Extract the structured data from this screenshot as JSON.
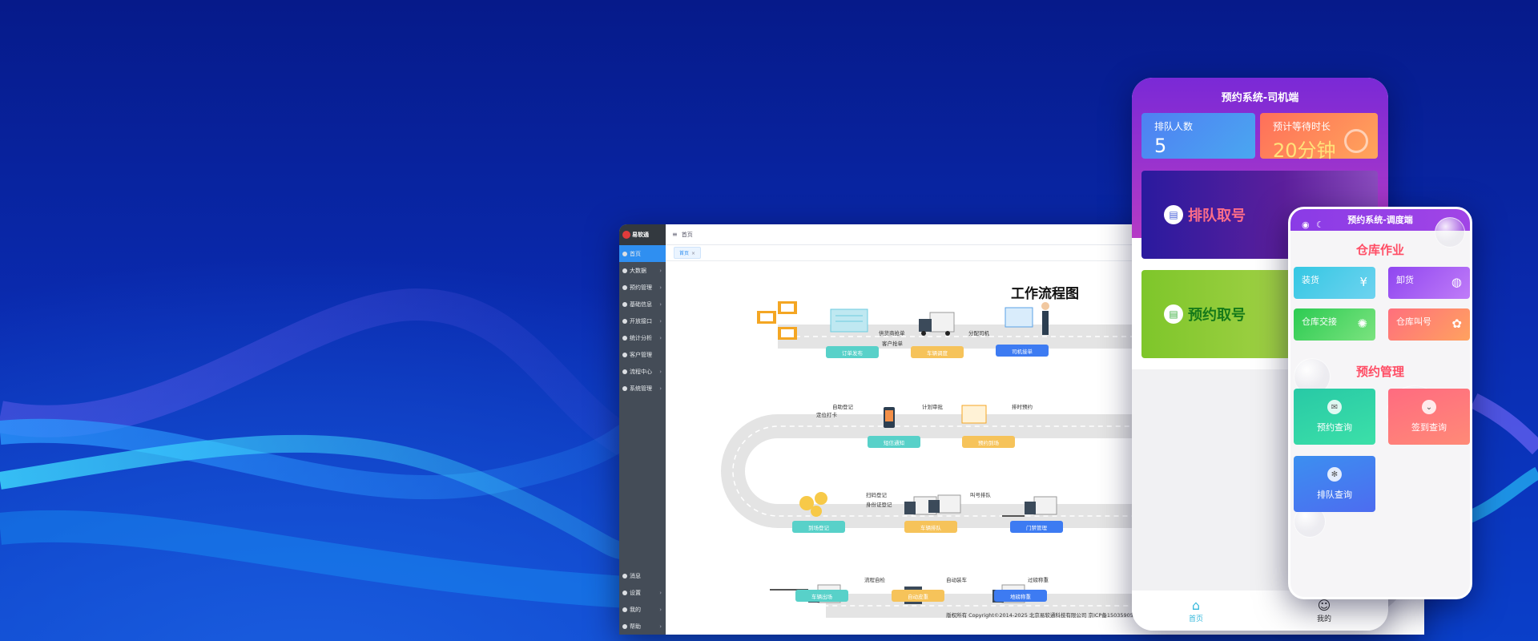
{
  "desktop": {
    "logo_text": "易软通",
    "breadcrumb": "首页",
    "tab_label": "首页",
    "tab_close": "×",
    "menu": [
      {
        "label": "首页",
        "active": true
      },
      {
        "label": "大数据",
        "chevron": true
      },
      {
        "label": "预约管理",
        "chevron": true
      },
      {
        "label": "基础信息",
        "chevron": true
      },
      {
        "label": "开放接口",
        "chevron": true
      },
      {
        "label": "统计分析",
        "chevron": true
      },
      {
        "label": "客户管理"
      },
      {
        "label": "流程中心",
        "chevron": true
      },
      {
        "label": "系统管理",
        "chevron": true
      }
    ],
    "menu_bottom": [
      {
        "label": "消息"
      },
      {
        "label": "设置",
        "chevron": true
      },
      {
        "label": "我的",
        "chevron": true
      },
      {
        "label": "帮助",
        "chevron": true
      }
    ],
    "flow_title": "工作流程图",
    "steps": {
      "order_publish": "订单发布",
      "vehicle_dispatch": "车辆调度",
      "driver_accept": "司机接单",
      "sms_notice": "短信通知",
      "appointment": "预约到场",
      "arrival_register": "到场登记",
      "vehicle_queue": "车辆排队",
      "gate_manage": "门禁管理",
      "vehicle_exit": "车辆出场",
      "auto_tare": "自动皮重",
      "ground_weigh": "地磅称重"
    },
    "labels": {
      "supplier_order": "供货商抢单",
      "customer_order": "客户抢单",
      "assign_driver": "分配司机",
      "self_register": "自助登记",
      "gps_checkin": "定位打卡",
      "plan_review": "计划审批",
      "timed_booking": "排时预约",
      "scan_register": "扫码登记",
      "id_register": "身份证登记",
      "call_queue": "叫号排队",
      "process_auto": "流程自检",
      "auto_load": "自动装车",
      "pass_weigh": "过磅称重"
    },
    "footer": "版权所有 Copyright©2014-2025 北京易软通科技有限公司 京ICP备15035905号-1"
  },
  "phone_driver": {
    "title": "预约系统-司机端",
    "queue_count_label": "排队人数",
    "queue_count_value": "5",
    "wait_time_label": "预计等待时长",
    "wait_time_value": "20分钟",
    "queue_card": "排队取号",
    "booking_card": "预约取号",
    "nav_home": "首页",
    "nav_mine": "我的"
  },
  "phone_dispatch": {
    "title": "预约系统-调度端",
    "section_warehouse": "仓库作业",
    "tiles": {
      "load": "装货",
      "unload": "卸货",
      "handover": "仓库交接",
      "call": "仓库叫号"
    },
    "section_booking": "预约管理",
    "cards": {
      "booking_query": "预约查询",
      "checkin_query": "签到查询",
      "queue_query": "排队查询"
    }
  },
  "colors": {
    "accent_blue": "#2f8ff1",
    "teal": "#58d1c9",
    "gold": "#f6c35a",
    "blue": "#3d7bf2",
    "warn_red": "#ff4d65"
  }
}
